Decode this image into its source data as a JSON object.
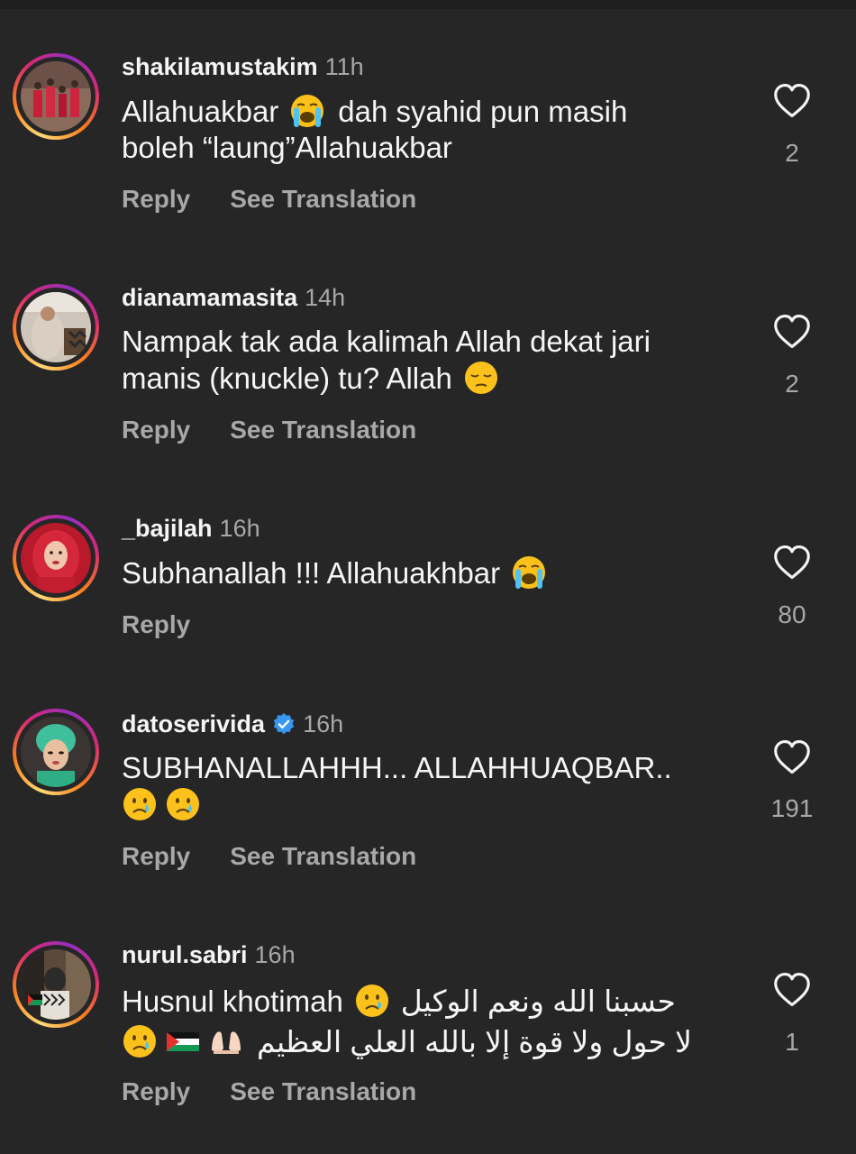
{
  "comments": [
    {
      "username": "shakilamustakim",
      "time": "11h",
      "lines": [
        "Allahuakbar",
        "dah syahid pun masih",
        "boleh “laung”Allahuakbar"
      ],
      "like_count": "2",
      "reply_label": "Reply",
      "translate_label": "See Translation"
    },
    {
      "username": "dianamamasita",
      "time": "14h",
      "lines": [
        "Nampak tak ada kalimah Allah dekat jari",
        "manis (knuckle) tu? Allah"
      ],
      "like_count": "2",
      "reply_label": "Reply",
      "translate_label": "See Translation"
    },
    {
      "username": "_bajilah",
      "time": "16h",
      "lines": [
        "Subhanallah !!! Allahuakhbar"
      ],
      "like_count": "80",
      "reply_label": "Reply"
    },
    {
      "username": "datoserivida",
      "verified": true,
      "time": "16h",
      "lines": [
        "SUBHANALLAHHH... ALLAHHUAQBAR.."
      ],
      "like_count": "191",
      "reply_label": "Reply",
      "translate_label": "See Translation"
    },
    {
      "username": "nurul.sabri",
      "time": "16h",
      "lines": [
        "Husnul khotimah",
        "حسبنا الله ونعم الوكيل",
        "لا حول ولا قوة إلا بالله العلي العظيم"
      ],
      "like_count": "1",
      "reply_label": "Reply",
      "translate_label": "See Translation"
    }
  ],
  "icons": {
    "heart": "heart-outline-icon",
    "verified": "verified-badge-icon",
    "emoji_loudly_crying": "loudly-crying-face-emoji",
    "emoji_pensive": "pensive-face-emoji",
    "emoji_crying": "crying-face-emoji",
    "emoji_palms_up": "palms-up-together-emoji",
    "emoji_flag": "palestine-flag-emoji"
  },
  "colors": {
    "background": "#262626",
    "text": "#f5f5f5",
    "muted": "#a8a8a8",
    "verified": "#3897f0"
  }
}
